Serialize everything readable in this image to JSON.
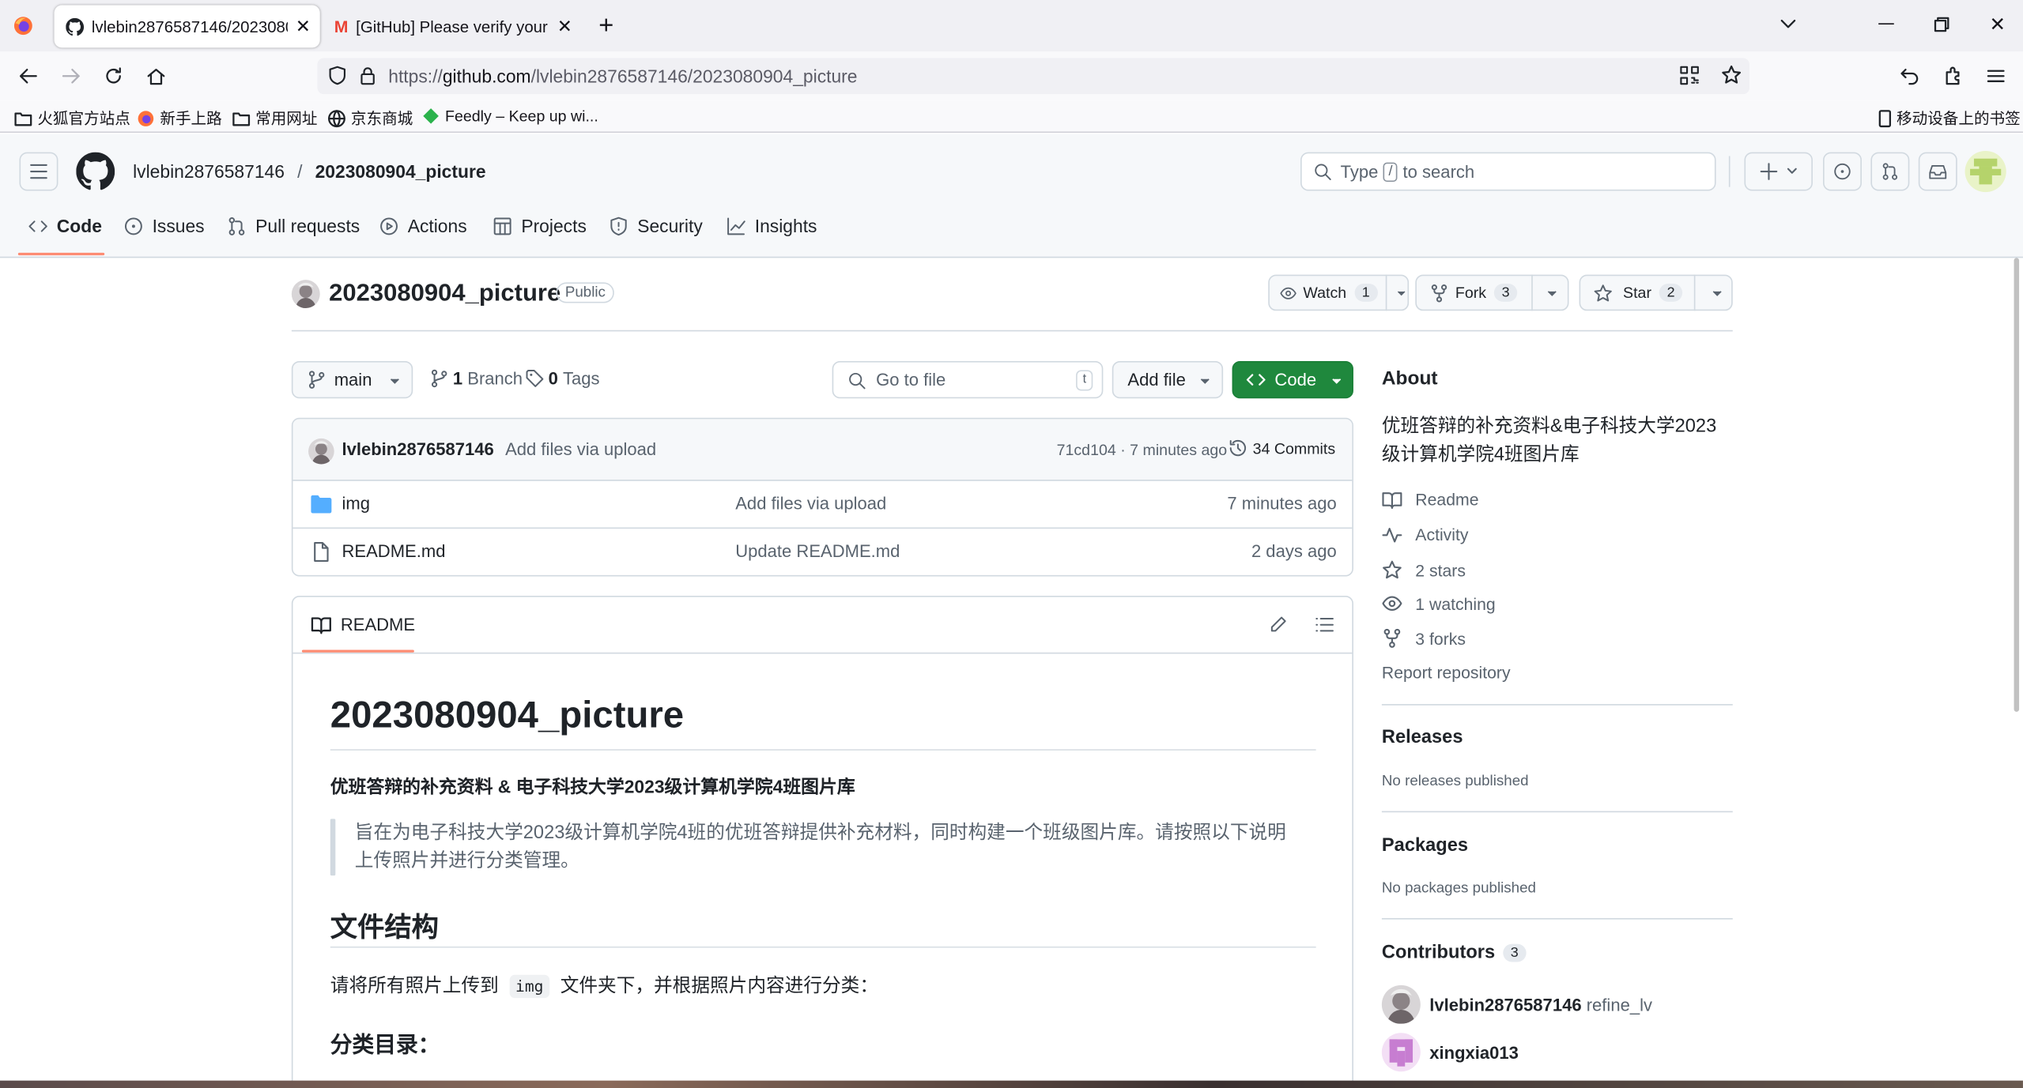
{
  "browser": {
    "tabs": [
      {
        "title": "lvlebin2876587146/2023080904_picture",
        "active": true
      },
      {
        "title": "[GitHub] Please verify your device",
        "active": false
      }
    ],
    "url_prefix": "https://",
    "url_domain": "github.com",
    "url_path": "/lvlebin2876587146/2023080904_picture",
    "bookmarks": [
      "火狐官方站点",
      "新手上路",
      "常用网址",
      "京东商城",
      "Feedly – Keep up wi..."
    ],
    "mobile_bookmarks": "移动设备上的书签"
  },
  "header": {
    "owner": "lvlebin2876587146",
    "separator": "/",
    "repo": "2023080904_picture",
    "search_type": "Type",
    "search_key": "/",
    "search_rest": "to search"
  },
  "nav": {
    "tabs": [
      "Code",
      "Issues",
      "Pull requests",
      "Actions",
      "Projects",
      "Security",
      "Insights"
    ],
    "active": "Code"
  },
  "repo": {
    "name": "2023080904_picture",
    "visibility": "Public",
    "watch_label": "Watch",
    "watch_count": "1",
    "fork_label": "Fork",
    "fork_count": "3",
    "star_label": "Star",
    "star_count": "2"
  },
  "toolbar": {
    "branch": "main",
    "branches_count": "1",
    "branches_label": "Branch",
    "tags_count": "0",
    "tags_label": "Tags",
    "goto_placeholder": "Go to file",
    "goto_key": "t",
    "add_file": "Add file",
    "code": "Code"
  },
  "commit": {
    "author": "lvlebin2876587146",
    "message": "Add files via upload",
    "hash": "71cd104",
    "time": "· 7 minutes ago",
    "commits": "34 Commits"
  },
  "files": [
    {
      "name": "img",
      "type": "folder",
      "message": "Add files via upload",
      "time": "7 minutes ago"
    },
    {
      "name": "README.md",
      "type": "file",
      "message": "Update README.md",
      "time": "2 days ago"
    }
  ],
  "readme": {
    "tab": "README",
    "h1": "2023080904_picture",
    "subtitle": "优班答辩的补充资料 & 电子科技大学2023级计算机学院4班图片库",
    "quote": "旨在为电子科技大学2023级计算机学院4班的优班答辩提供补充材料，同时构建一个班级图片库。请按照以下说明上传照片并进行分类管理。",
    "h2": "文件结构",
    "para_before": "请将所有照片上传到",
    "para_code": "img",
    "para_after": "文件夹下，并根据照片内容进行分类：",
    "h3": "分类目录："
  },
  "about": {
    "title": "About",
    "description": "优班答辩的补充资料&电子科技大学2023级计算机学院4班图片库",
    "links": [
      {
        "icon": "book-icon",
        "label": "Readme"
      },
      {
        "icon": "pulse-icon",
        "label": "Activity"
      },
      {
        "icon": "star-icon",
        "label": "2 stars"
      },
      {
        "icon": "eye-icon",
        "label": "1 watching"
      },
      {
        "icon": "fork-icon",
        "label": "3 forks"
      }
    ],
    "report": "Report repository"
  },
  "releases": {
    "title": "Releases",
    "empty": "No releases published"
  },
  "packages": {
    "title": "Packages",
    "empty": "No packages published"
  },
  "contributors": {
    "title": "Contributors",
    "count": "3",
    "people": [
      {
        "login": "lvlebin2876587146",
        "name": "refine_lv"
      },
      {
        "login": "xingxia013",
        "name": ""
      }
    ]
  },
  "colors": {
    "accent": "#fd8c73",
    "green": "#1f883d",
    "link": "#0969da",
    "folder": "#54aeff"
  }
}
